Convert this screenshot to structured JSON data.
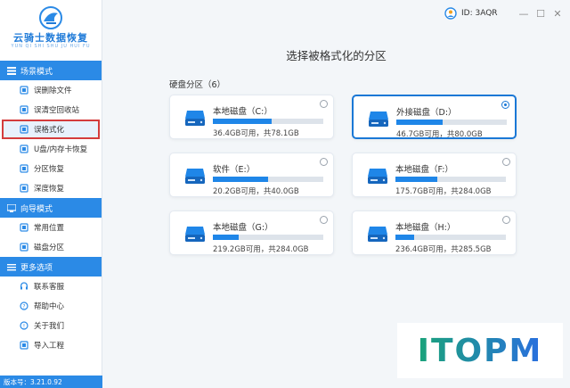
{
  "brand": {
    "title": "云骑士数据恢复",
    "subtitle": "YUN QI SHI SHU JU HUI FU",
    "color": "#1e7ad8"
  },
  "sidebar": {
    "sections": [
      {
        "label": "场景模式",
        "icon": "list-icon",
        "items": [
          {
            "label": "误删除文件",
            "icon": "file-delete-icon"
          },
          {
            "label": "误清空回收站",
            "icon": "recycle-bin-icon"
          },
          {
            "label": "误格式化",
            "icon": "format-disk-icon",
            "active": true
          },
          {
            "label": "U盘/内存卡恢复",
            "icon": "usb-drive-icon"
          },
          {
            "label": "分区恢复",
            "icon": "partition-icon"
          },
          {
            "label": "深度恢复",
            "icon": "deep-scan-icon"
          }
        ]
      },
      {
        "label": "向导模式",
        "icon": "guide-icon",
        "items": [
          {
            "label": "常用位置",
            "icon": "location-icon"
          },
          {
            "label": "磁盘分区",
            "icon": "disk-partition-icon"
          }
        ]
      },
      {
        "label": "更多选项",
        "icon": "menu-icon",
        "items": [
          {
            "label": "联系客服",
            "icon": "headset-icon"
          },
          {
            "label": "帮助中心",
            "icon": "help-icon"
          },
          {
            "label": "关于我们",
            "icon": "info-icon"
          },
          {
            "label": "导入工程",
            "icon": "import-icon"
          }
        ]
      }
    ],
    "version": "版本号：3.21.0.92"
  },
  "header": {
    "id_label": "ID: 3AQR",
    "minimize": "—",
    "maximize": "☐",
    "close": "✕"
  },
  "main": {
    "title": "选择被格式化的分区",
    "section_label": "硬盘分区（6）",
    "partitions": [
      {
        "name": "本地磁盘（C:）",
        "size": "36.4GB可用，共78.1GB",
        "used_fraction": 0.53,
        "selected": false
      },
      {
        "name": "外接磁盘（D:）",
        "size": "46.7GB可用，共80.0GB",
        "used_fraction": 0.42,
        "selected": true
      },
      {
        "name": "软件（E:）",
        "size": "20.2GB可用，共40.0GB",
        "used_fraction": 0.5,
        "selected": false
      },
      {
        "name": "本地磁盘（F:）",
        "size": "175.7GB可用，共284.0GB",
        "used_fraction": 0.38,
        "selected": false
      },
      {
        "name": "本地磁盘（G:）",
        "size": "219.2GB可用，共284.0GB",
        "used_fraction": 0.23,
        "selected": false
      },
      {
        "name": "本地磁盘（H:）",
        "size": "236.4GB可用，共285.5GB",
        "used_fraction": 0.17,
        "selected": false
      }
    ]
  },
  "watermark": {
    "text": "ITOPM",
    "color_start": "#1aa37a",
    "color_end": "#2a6fe0"
  },
  "colors": {
    "accent": "#2b8ae6",
    "bar_fill": "#1f86e8",
    "selected_border": "#1a78d6",
    "active_outline": "#d43c3c"
  }
}
